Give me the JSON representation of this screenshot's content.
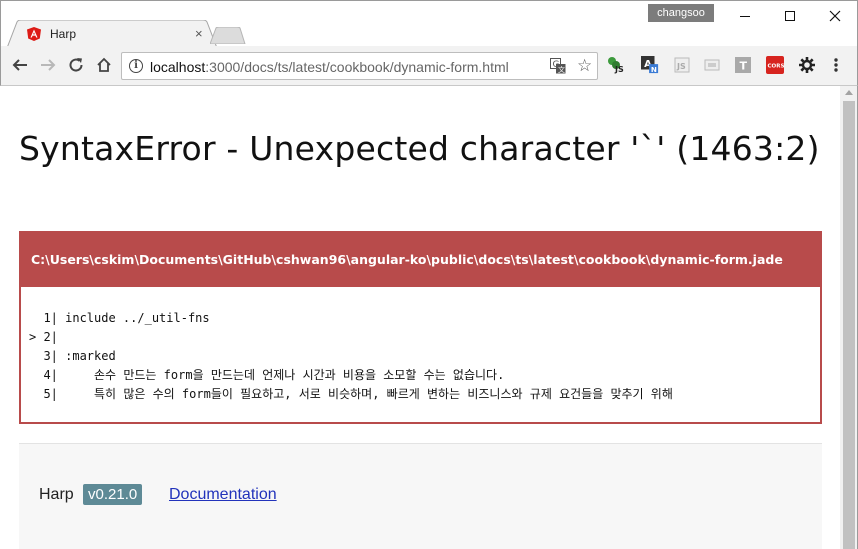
{
  "window": {
    "profile_name": "changsoo",
    "minimize_icon": "minimize-icon",
    "maximize_icon": "maximize-icon",
    "close_icon": "close-icon"
  },
  "tab": {
    "title": "Harp",
    "favicon": "angular-icon",
    "close_glyph": "×"
  },
  "omnibox": {
    "host": "localhost",
    "path": ":3000/docs/ts/latest/cookbook/dynamic-form.html"
  },
  "extensions": [
    {
      "name": "js-extension-icon",
      "label": "JS"
    },
    {
      "name": "translate-ext-icon",
      "label": "A"
    },
    {
      "name": "js-ext-2-icon",
      "label": "JS"
    },
    {
      "name": "screen-ext-icon",
      "label": ""
    },
    {
      "name": "text-ext-icon",
      "label": "T"
    },
    {
      "name": "cors-ext-icon",
      "label": "CORS"
    },
    {
      "name": "puzzle-ext-icon",
      "label": ""
    },
    {
      "name": "menu-icon",
      "label": "⋮"
    }
  ],
  "error": {
    "title": "SyntaxError - Unexpected character '`' (1463:2)",
    "file_path": "C:\\Users\\cskim\\Documents\\GitHub\\cshwan96\\angular-ko\\public\\docs\\ts\\latest\\cookbook\\dynamic-form.jade",
    "lines": [
      "  1| include ../_util-fns",
      "> 2|",
      "  3| :marked",
      "  4|     손수 만드는 form을 만드는데 언제나 시간과 비용을 소모할 수는 없습니다.",
      "  5|     특히 많은 수의 form들이 필요하고, 서로 비슷하며, 빠르게 변하는 비즈니스와 규제 요건들을 맞추기 위해"
    ]
  },
  "footer": {
    "brand": "Harp",
    "version": "v0.21.0",
    "doc_link": "Documentation"
  },
  "colors": {
    "error_accent": "#b84b4b",
    "version_badge": "#5e8a96",
    "link": "#2233bb"
  }
}
